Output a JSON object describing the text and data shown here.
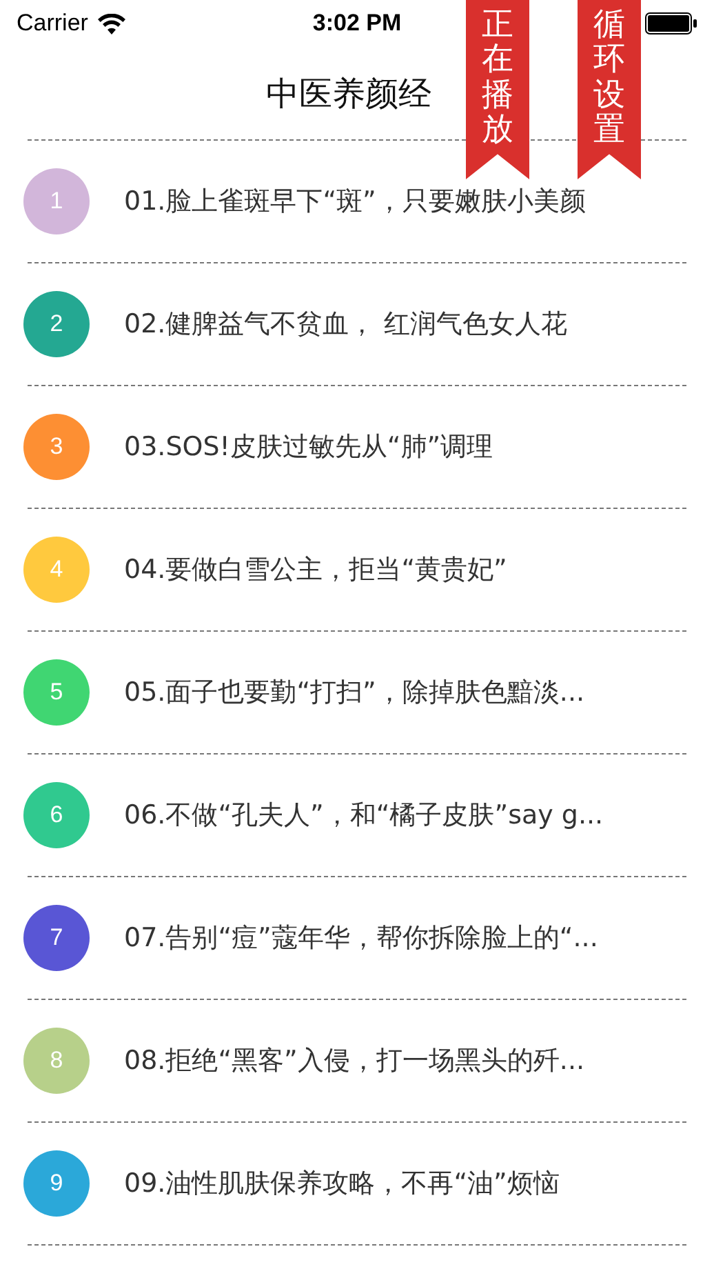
{
  "status_bar": {
    "carrier": "Carrier",
    "time": "3:02 PM"
  },
  "title": "中医养颜经",
  "ribbons": [
    {
      "label": "正在播放"
    },
    {
      "label": "循环设置"
    }
  ],
  "episodes": [
    {
      "number": "1",
      "title": "01.脸上雀斑早下“斑”，只要嫩肤小美颜",
      "color": "#d2b6da"
    },
    {
      "number": "2",
      "title": "02.健脾益气不贫血， 红润气色女人花",
      "color": "#24a892"
    },
    {
      "number": "3",
      "title": "03.SOS!皮肤过敏先从“肺”调理",
      "color": "#fd8f33"
    },
    {
      "number": "4",
      "title": "04.要做白雪公主，拒当“黄贵妃”",
      "color": "#ffc93e"
    },
    {
      "number": "5",
      "title": "05.面子也要勤“打扫”，除掉肤色黯淡...",
      "color": "#40d672"
    },
    {
      "number": "6",
      "title": "06.不做“孔夫人”，和“橘子皮肤”say g...",
      "color": "#30c98f"
    },
    {
      "number": "7",
      "title": "07.告别“痘”蔻年华，帮你拆除脸上的“...",
      "color": "#5956d5"
    },
    {
      "number": "8",
      "title": "08.拒绝“黑客”入侵，打一场黑头的歼...",
      "color": "#b7d08a"
    },
    {
      "number": "9",
      "title": "09.油性肌肤保养攻略，不再“油”烦恼",
      "color": "#2ba8d9"
    }
  ]
}
